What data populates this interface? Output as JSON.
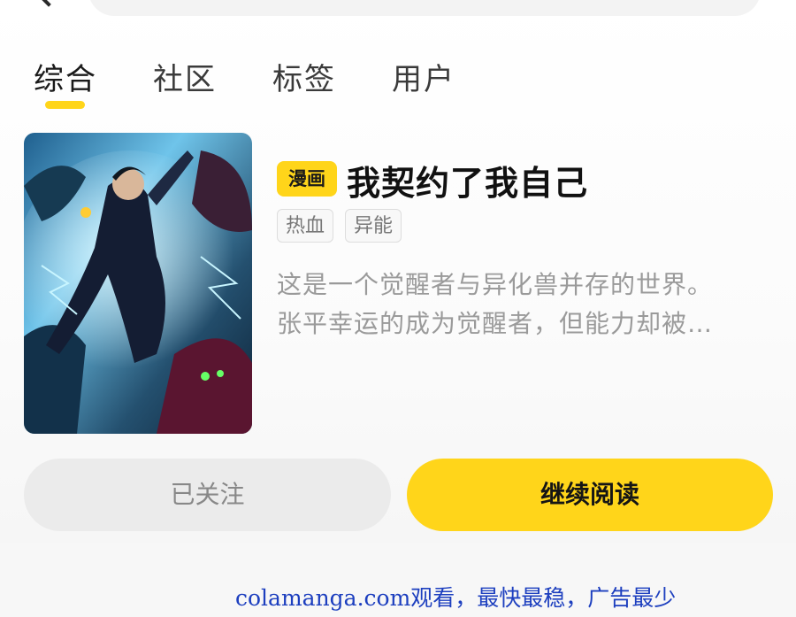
{
  "header": {
    "back_icon": "chevron-left-icon"
  },
  "tabs": [
    {
      "label": "综合",
      "active": true
    },
    {
      "label": "社区",
      "active": false
    },
    {
      "label": "标签",
      "active": false
    },
    {
      "label": "用户",
      "active": false
    }
  ],
  "result": {
    "type_badge": "漫画",
    "title": "我契约了我自己",
    "tags": [
      "热血",
      "异能"
    ],
    "description_lines": [
      "这是一个觉醒者与异化兽并存的世界。",
      "张平幸运的成为觉醒者，但能力却被…"
    ]
  },
  "actions": {
    "follow_label": "已关注",
    "read_label": "继续阅读"
  },
  "watermark": "colamanga.com观看，最快最稳，广告最少",
  "colors": {
    "accent": "#ffd51a",
    "watermark": "#1d3fbf"
  }
}
